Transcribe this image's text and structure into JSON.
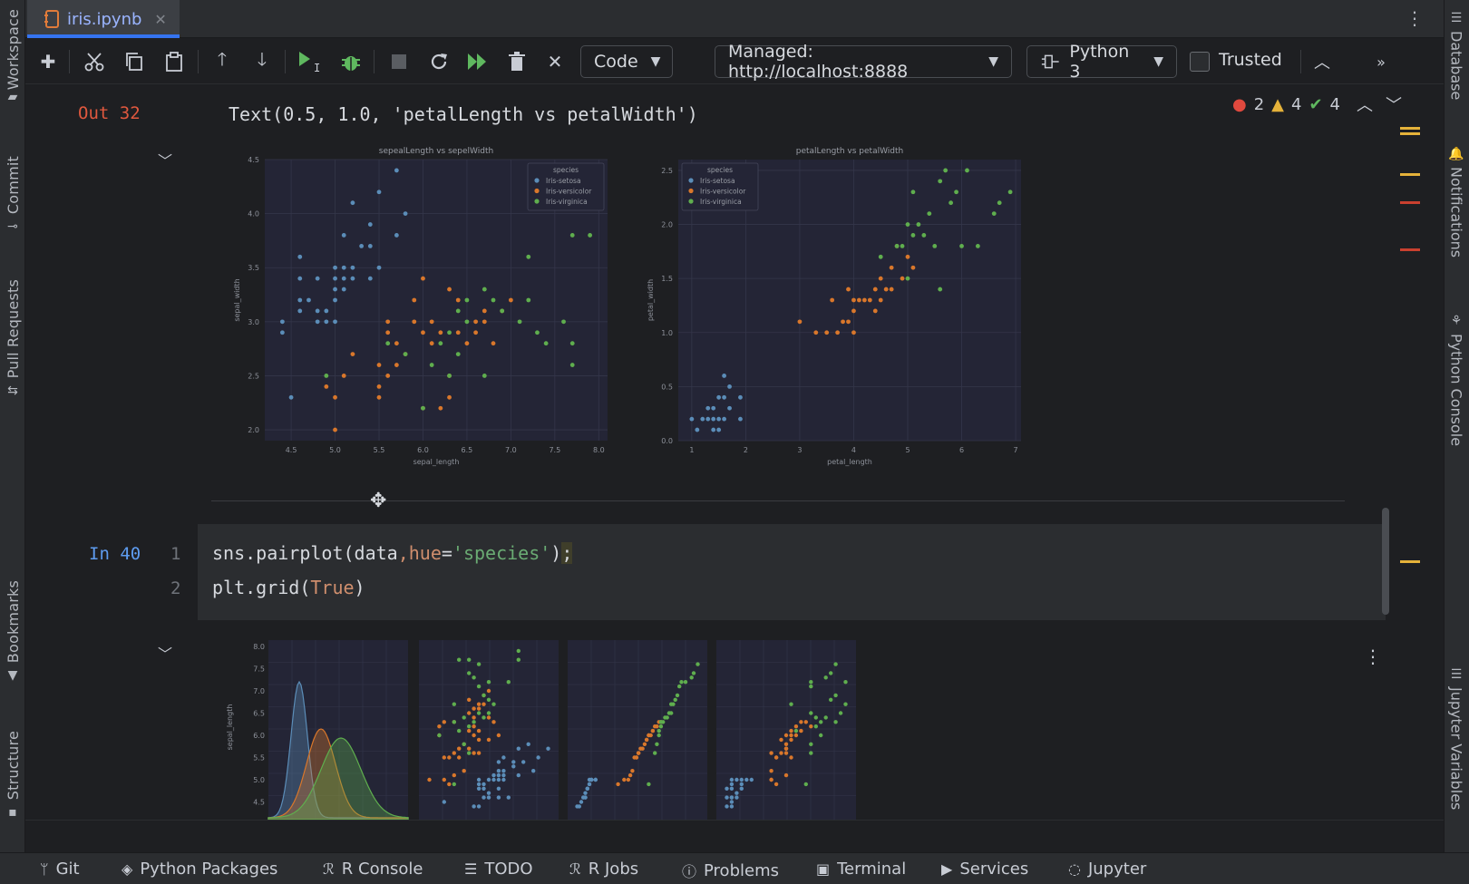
{
  "tab": {
    "filename": "iris.ipynb",
    "close": "✕"
  },
  "toolbar": {
    "cell_type": "Code",
    "server": "Managed: http://localhost:8888",
    "kernel": "Python 3",
    "trusted": "Trusted"
  },
  "inspections": {
    "errors": "2",
    "warnings": "4",
    "ok": "4"
  },
  "output_cell": {
    "label": "Out 32",
    "text": "Text(0.5, 1.0, 'petalLength vs petalWidth')"
  },
  "input_cell": {
    "label": "In 40",
    "line_numbers": [
      "1",
      "2"
    ],
    "code": {
      "l1_a": "sns.pairplot(data",
      "l1_b": ",",
      "l1_c": "hue",
      "l1_d": "=",
      "l1_e": "'species'",
      "l1_f": ")",
      "l1_g": ";",
      "l2_a": "plt.grid(",
      "l2_b": "True",
      "l2_c": ")"
    }
  },
  "left_tools": [
    "Workspace",
    "Commit",
    "Pull Requests",
    "Bookmarks",
    "Structure"
  ],
  "right_tools": [
    "Database",
    "Notifications",
    "Python Console",
    "Jupyter Variables"
  ],
  "bottom_tools": [
    "Git",
    "Python Packages",
    "R Console",
    "TODO",
    "R Jobs",
    "Problems",
    "Terminal",
    "Services",
    "Jupyter"
  ],
  "colors": {
    "setosa": "#5b8db8",
    "versicolor": "#d9772b",
    "virginica": "#5fae4e",
    "plot_bg": "#242536"
  },
  "chart_data": [
    {
      "type": "scatter",
      "title": "sepealLength vs sepelWidth",
      "xlabel": "sepal_length",
      "ylabel": "sepal_width",
      "xlim": [
        4.2,
        8.1
      ],
      "ylim": [
        1.9,
        4.5
      ],
      "xticks": [
        "4.5",
        "5.0",
        "5.5",
        "6.0",
        "6.5",
        "7.0",
        "7.5",
        "8.0"
      ],
      "yticks": [
        "2.0",
        "2.5",
        "3.0",
        "3.5",
        "4.0",
        "4.5"
      ],
      "legend_title": "species",
      "legend_position": "top-right",
      "series": [
        {
          "name": "Iris-setosa",
          "points": [
            [
              4.4,
              3.0
            ],
            [
              4.4,
              2.9
            ],
            [
              4.5,
              2.3
            ],
            [
              4.6,
              3.1
            ],
            [
              4.6,
              3.4
            ],
            [
              4.6,
              3.6
            ],
            [
              4.6,
              3.2
            ],
            [
              4.7,
              3.2
            ],
            [
              4.8,
              3.0
            ],
            [
              4.8,
              3.4
            ],
            [
              4.8,
              3.1
            ],
            [
              4.9,
              3.0
            ],
            [
              4.9,
              3.1
            ],
            [
              5.0,
              3.4
            ],
            [
              5.0,
              3.0
            ],
            [
              5.0,
              3.2
            ],
            [
              5.0,
              3.5
            ],
            [
              5.0,
              3.3
            ],
            [
              5.1,
              3.5
            ],
            [
              5.1,
              3.8
            ],
            [
              5.1,
              3.3
            ],
            [
              5.1,
              3.4
            ],
            [
              5.2,
              3.4
            ],
            [
              5.2,
              3.5
            ],
            [
              5.2,
              4.1
            ],
            [
              5.3,
              3.7
            ],
            [
              5.4,
              3.9
            ],
            [
              5.4,
              3.4
            ],
            [
              5.4,
              3.7
            ],
            [
              5.5,
              4.2
            ],
            [
              5.5,
              3.5
            ],
            [
              5.7,
              3.8
            ],
            [
              5.7,
              4.4
            ],
            [
              5.8,
              4.0
            ]
          ]
        },
        {
          "name": "Iris-versicolor",
          "points": [
            [
              4.9,
              2.4
            ],
            [
              5.0,
              2.0
            ],
            [
              5.0,
              2.3
            ],
            [
              5.1,
              2.5
            ],
            [
              5.2,
              2.7
            ],
            [
              5.5,
              2.3
            ],
            [
              5.5,
              2.4
            ],
            [
              5.5,
              2.6
            ],
            [
              5.6,
              2.9
            ],
            [
              5.6,
              3.0
            ],
            [
              5.6,
              2.5
            ],
            [
              5.7,
              2.8
            ],
            [
              5.7,
              2.6
            ],
            [
              5.8,
              2.7
            ],
            [
              5.9,
              3.0
            ],
            [
              5.9,
              3.2
            ],
            [
              6.0,
              2.2
            ],
            [
              6.0,
              2.9
            ],
            [
              6.0,
              3.4
            ],
            [
              6.1,
              2.8
            ],
            [
              6.1,
              3.0
            ],
            [
              6.2,
              2.2
            ],
            [
              6.2,
              2.9
            ],
            [
              6.3,
              2.3
            ],
            [
              6.3,
              2.5
            ],
            [
              6.3,
              3.3
            ],
            [
              6.4,
              2.9
            ],
            [
              6.4,
              3.2
            ],
            [
              6.5,
              2.8
            ],
            [
              6.6,
              2.9
            ],
            [
              6.6,
              3.0
            ],
            [
              6.7,
              3.1
            ],
            [
              6.7,
              3.0
            ],
            [
              6.8,
              2.8
            ],
            [
              6.9,
              3.1
            ],
            [
              7.0,
              3.2
            ]
          ]
        },
        {
          "name": "Iris-virginica",
          "points": [
            [
              4.9,
              2.5
            ],
            [
              5.6,
              2.8
            ],
            [
              5.8,
              2.7
            ],
            [
              6.0,
              2.2
            ],
            [
              6.1,
              2.6
            ],
            [
              6.2,
              2.8
            ],
            [
              6.3,
              2.5
            ],
            [
              6.3,
              2.9
            ],
            [
              6.4,
              2.7
            ],
            [
              6.4,
              3.1
            ],
            [
              6.5,
              3.0
            ],
            [
              6.5,
              3.2
            ],
            [
              6.7,
              2.5
            ],
            [
              6.7,
              3.3
            ],
            [
              6.8,
              3.2
            ],
            [
              6.9,
              3.1
            ],
            [
              7.1,
              3.0
            ],
            [
              7.2,
              3.6
            ],
            [
              7.2,
              3.2
            ],
            [
              7.3,
              2.9
            ],
            [
              7.4,
              2.8
            ],
            [
              7.6,
              3.0
            ],
            [
              7.7,
              3.8
            ],
            [
              7.7,
              2.6
            ],
            [
              7.7,
              2.8
            ],
            [
              7.9,
              3.8
            ]
          ]
        }
      ]
    },
    {
      "type": "scatter",
      "title": "petalLength vs petalWidth",
      "xlabel": "petal_length",
      "ylabel": "petal_width",
      "xlim": [
        0.75,
        7.1
      ],
      "ylim": [
        0.0,
        2.6
      ],
      "xticks": [
        "1",
        "2",
        "3",
        "4",
        "5",
        "6",
        "7"
      ],
      "yticks": [
        "0.0",
        "0.5",
        "1.0",
        "1.5",
        "2.0",
        "2.5"
      ],
      "legend_title": "species",
      "legend_position": "top-left",
      "series": [
        {
          "name": "Iris-setosa",
          "points": [
            [
              1.0,
              0.2
            ],
            [
              1.1,
              0.1
            ],
            [
              1.2,
              0.2
            ],
            [
              1.3,
              0.2
            ],
            [
              1.3,
              0.3
            ],
            [
              1.4,
              0.2
            ],
            [
              1.4,
              0.1
            ],
            [
              1.4,
              0.3
            ],
            [
              1.5,
              0.2
            ],
            [
              1.5,
              0.4
            ],
            [
              1.5,
              0.1
            ],
            [
              1.6,
              0.2
            ],
            [
              1.6,
              0.4
            ],
            [
              1.6,
              0.6
            ],
            [
              1.7,
              0.3
            ],
            [
              1.7,
              0.5
            ],
            [
              1.9,
              0.2
            ],
            [
              1.9,
              0.4
            ]
          ]
        },
        {
          "name": "Iris-versicolor",
          "points": [
            [
              3.0,
              1.1
            ],
            [
              3.3,
              1.0
            ],
            [
              3.5,
              1.0
            ],
            [
              3.6,
              1.3
            ],
            [
              3.7,
              1.0
            ],
            [
              3.8,
              1.1
            ],
            [
              3.9,
              1.1
            ],
            [
              3.9,
              1.4
            ],
            [
              4.0,
              1.0
            ],
            [
              4.0,
              1.2
            ],
            [
              4.0,
              1.3
            ],
            [
              4.1,
              1.3
            ],
            [
              4.2,
              1.3
            ],
            [
              4.3,
              1.3
            ],
            [
              4.4,
              1.4
            ],
            [
              4.4,
              1.2
            ],
            [
              4.5,
              1.5
            ],
            [
              4.5,
              1.3
            ],
            [
              4.6,
              1.4
            ],
            [
              4.7,
              1.4
            ],
            [
              4.7,
              1.6
            ],
            [
              4.8,
              1.8
            ],
            [
              4.9,
              1.5
            ],
            [
              5.0,
              1.7
            ],
            [
              5.1,
              1.6
            ]
          ]
        },
        {
          "name": "Iris-virginica",
          "points": [
            [
              4.5,
              1.7
            ],
            [
              4.8,
              1.8
            ],
            [
              4.9,
              1.8
            ],
            [
              5.0,
              2.0
            ],
            [
              5.0,
              1.5
            ],
            [
              5.1,
              1.9
            ],
            [
              5.1,
              2.3
            ],
            [
              5.2,
              2.0
            ],
            [
              5.3,
              1.9
            ],
            [
              5.4,
              2.1
            ],
            [
              5.5,
              1.8
            ],
            [
              5.6,
              2.4
            ],
            [
              5.6,
              1.4
            ],
            [
              5.7,
              2.5
            ],
            [
              5.8,
              2.2
            ],
            [
              5.9,
              2.3
            ],
            [
              6.0,
              1.8
            ],
            [
              6.1,
              2.5
            ],
            [
              6.3,
              1.8
            ],
            [
              6.6,
              2.1
            ],
            [
              6.7,
              2.2
            ],
            [
              6.9,
              2.3
            ]
          ]
        }
      ]
    }
  ],
  "pairplot": {
    "ylabel": "sepal_length",
    "yticks": [
      "8.0",
      "7.5",
      "7.0",
      "6.5",
      "6.0",
      "5.5",
      "5.0",
      "4.5"
    ]
  }
}
